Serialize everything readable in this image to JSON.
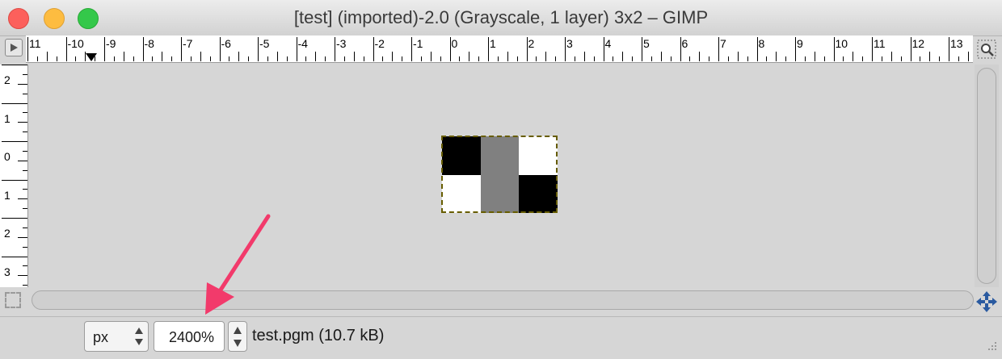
{
  "window": {
    "title": "[test] (imported)-2.0 (Grayscale, 1 layer) 3x2 – GIMP"
  },
  "ruler_h": {
    "labels": [
      "11",
      "-10",
      "-9",
      "-8",
      "-7",
      "-6",
      "-5",
      "-4",
      "-3",
      "-2",
      "-1",
      "0",
      "1",
      "2",
      "3",
      "4",
      "5",
      "6",
      "7",
      "8",
      "9",
      "10",
      "11",
      "12",
      "13"
    ]
  },
  "ruler_v": {
    "labels": [
      "2",
      "1",
      "0",
      "1",
      "2",
      "3"
    ]
  },
  "image": {
    "pixels": [
      [
        "#000000",
        "#808080",
        "#ffffff"
      ],
      [
        "#ffffff",
        "#808080",
        "#000000"
      ]
    ]
  },
  "statusbar": {
    "unit": "px",
    "zoom": "2400",
    "zoom_unit": "%",
    "file_info": "test.pgm (10.7 kB)"
  },
  "colors": {
    "selection": "#e6d000",
    "annotation_arrow": "#f23a6b",
    "navigate_icon": "#2a5aa0"
  },
  "icons": {
    "ruler_menu": "triangle-right-icon",
    "zoom_toggle": "zoom-window-icon",
    "quick_mask": "quick-mask-icon",
    "navigate": "navigate-icon"
  }
}
